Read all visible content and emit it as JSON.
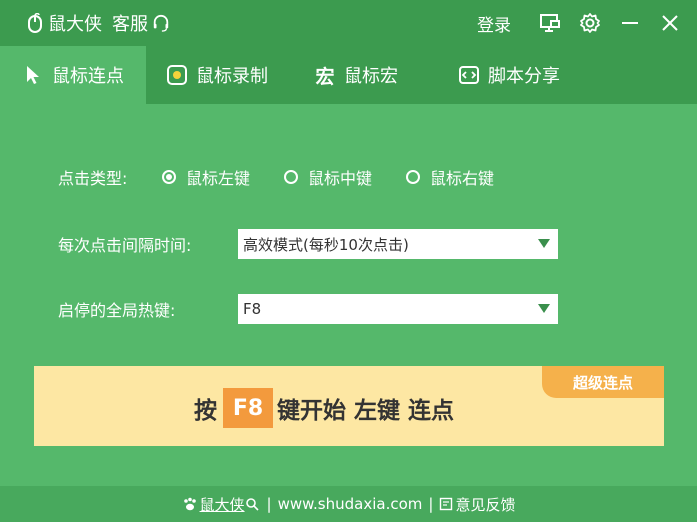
{
  "titlebar": {
    "app_name": "鼠大侠",
    "service": "客服",
    "login": "登录"
  },
  "tabs": [
    {
      "label": "鼠标连点",
      "icon": "cursor-arrow-icon",
      "active": true
    },
    {
      "label": "鼠标录制",
      "icon": "record-icon",
      "active": false
    },
    {
      "label": "鼠标宏",
      "icon": "macro-glyph-icon",
      "active": false
    },
    {
      "label": "脚本分享",
      "icon": "script-code-icon",
      "active": false
    }
  ],
  "click_type": {
    "label": "点击类型:",
    "options": [
      "鼠标左键",
      "鼠标中键",
      "鼠标右键"
    ],
    "selected": "鼠标左键"
  },
  "interval": {
    "label": "每次点击间隔时间:",
    "value": "高效模式(每秒10次点击)"
  },
  "hotkey": {
    "label": "启停的全局热键:",
    "value": "F8"
  },
  "banner": {
    "badge": "超级连点",
    "prefix": "按",
    "key": "F8",
    "text1": "键开始",
    "text2": "左键",
    "text3": "连点"
  },
  "footer": {
    "brand": "鼠大侠",
    "site": "www.shudaxia.com",
    "feedback": "意见反馈",
    "separator": "|"
  },
  "colors": {
    "bg": "#55b86b",
    "titlebar": "#3c9b4f",
    "banner": "#fde7a3",
    "badge": "#f5b14b",
    "key": "#f39a3d"
  }
}
